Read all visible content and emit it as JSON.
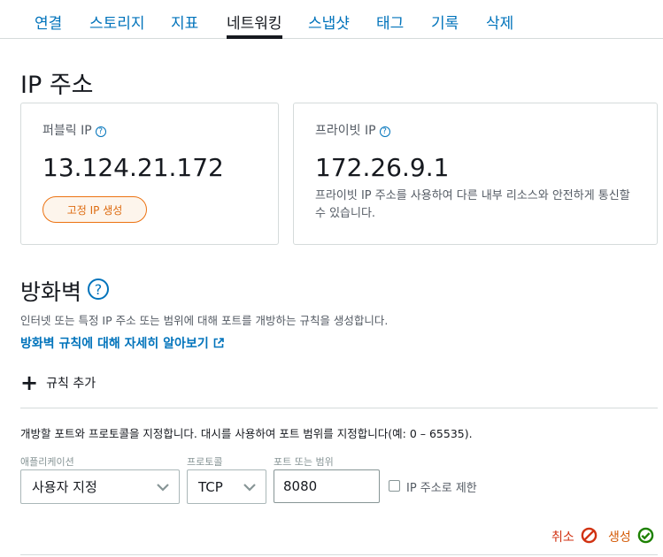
{
  "tabs": [
    {
      "label": "연결"
    },
    {
      "label": "스토리지"
    },
    {
      "label": "지표"
    },
    {
      "label": "네트워킹"
    },
    {
      "label": "스냅샷"
    },
    {
      "label": "태그"
    },
    {
      "label": "기록"
    },
    {
      "label": "삭제"
    }
  ],
  "active_tab": "네트워킹",
  "ip_section": {
    "title": "IP 주소",
    "public": {
      "label": "퍼블릭 IP",
      "value": "13.124.21.172",
      "button": "고정 IP 생성"
    },
    "private": {
      "label": "프라이빗 IP",
      "value": "172.26.9.1",
      "description": "프라이빗 IP 주소를 사용하여 다른 내부 리소스와 안전하게 통신할 수 있습니다."
    }
  },
  "firewall": {
    "title": "방화벽",
    "description": "인터넷 또는 특정 IP 주소 또는 범위에 대해 포트를 개방하는 규칙을 생성합니다.",
    "learn_more": "방화벽 규칙에 대해 자세히 알아보기",
    "add_rule": "규칙 추가",
    "instructions": "개방할 포트와 프로토콜을 지정합니다. 대시를 사용하여 포트 범위를 지정합니다(예: 0 – 65535).",
    "application": {
      "label": "애플리케이션",
      "value": "사용자 지정"
    },
    "protocol": {
      "label": "프로토콜",
      "value": "TCP"
    },
    "port": {
      "label": "포트 또는 범위",
      "value": "8080"
    },
    "restrict_ip": {
      "label": "IP 주소로 제한",
      "checked": false
    },
    "cancel": "취소",
    "create": "생성"
  },
  "colors": {
    "link": "#0073bb",
    "accent": "#ec7211",
    "cancel": "#d13212",
    "confirm": "#1d8102"
  },
  "icons": [
    "help-icon",
    "external-link-icon",
    "plus-icon",
    "chevron-down-icon",
    "cancel-icon",
    "check-circle-icon"
  ]
}
